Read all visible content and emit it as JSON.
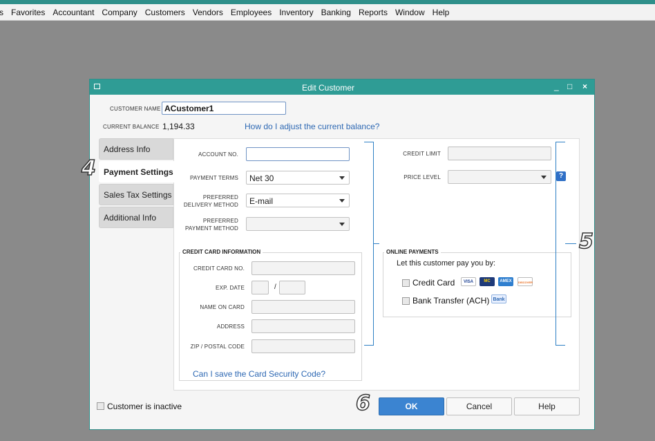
{
  "menu": [
    "s",
    "Favorites",
    "Accountant",
    "Company",
    "Customers",
    "Vendors",
    "Employees",
    "Inventory",
    "Banking",
    "Reports",
    "Window",
    "Help"
  ],
  "window": {
    "title": "Edit Customer",
    "minimize": "_",
    "maximize": "□",
    "close": "×"
  },
  "customer": {
    "name_label": "CUSTOMER NAME",
    "name_value": "ACustomer1",
    "balance_label": "CURRENT BALANCE",
    "balance_value": "1,194.33",
    "balance_link": "How do I adjust the current balance?"
  },
  "tabs": [
    "Address Info",
    "Payment Settings",
    "Sales Tax Settings",
    "Additional Info"
  ],
  "payment": {
    "account_no_label": "ACCOUNT NO.",
    "account_no_value": "",
    "payment_terms_label": "PAYMENT TERMS",
    "payment_terms_value": "Net 30",
    "delivery_label_1": "PREFERRED",
    "delivery_label_2": "DELIVERY METHOD",
    "delivery_value": "E-mail",
    "pay_method_label_1": "PREFERRED",
    "pay_method_label_2": "PAYMENT METHOD",
    "pay_method_value": "",
    "credit_limit_label": "CREDIT LIMIT",
    "credit_limit_value": "",
    "price_level_label": "PRICE LEVEL",
    "price_level_value": "",
    "help_badge": "?"
  },
  "credit_card": {
    "title": "CREDIT CARD INFORMATION",
    "card_no_label": "CREDIT CARD NO.",
    "exp_label": "EXP. DATE",
    "exp_sep": "/",
    "name_label": "NAME ON CARD",
    "address_label": "ADDRESS",
    "zip_label": "ZIP / POSTAL CODE",
    "security_link": "Can I save the Card Security Code?"
  },
  "online": {
    "title": "ONLINE PAYMENTS",
    "intro": "Let this customer pay you by:",
    "credit_card_label": "Credit Card",
    "bank_label": "Bank Transfer (ACH)",
    "cards": [
      "VISA",
      "MC",
      "AMEX",
      "DISCOVER"
    ],
    "bank_badge": "Bank"
  },
  "footer": {
    "inactive_label": "Customer is inactive",
    "ok": "OK",
    "cancel": "Cancel",
    "help": "Help"
  },
  "annotations": [
    "4",
    "5",
    "6"
  ],
  "colors": {
    "accent": "#2f9c95",
    "link": "#2d68b3",
    "primary_button": "#3b84d1",
    "bracket": "#2d7fc4"
  }
}
